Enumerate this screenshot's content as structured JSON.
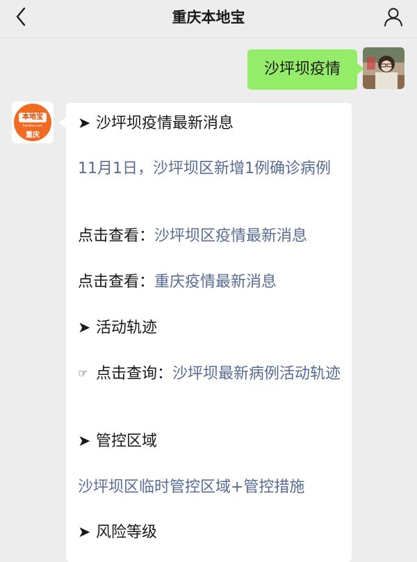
{
  "header": {
    "title": "重庆本地宝",
    "back_icon": "chevron-left-icon",
    "profile_icon": "person-icon"
  },
  "messages": {
    "outgoing": {
      "text": "沙坪坝疫情",
      "bubble_color": "#95ec69"
    },
    "incoming": {
      "avatar": {
        "logo_text": "本地宝",
        "logo_url": "Bendibao.com",
        "logo_city": "重庆",
        "logo_color": "#ef6b23"
      },
      "arrow_symbol": "➤",
      "hand_symbol": "☞",
      "sections": [
        {
          "heading": "沙坪坝疫情最新消息"
        },
        {
          "link": "11月1日，沙坪坝区新增1例确诊病例"
        },
        {
          "prefix": "点击查看：",
          "link": "沙坪坝区疫情最新消息"
        },
        {
          "prefix": "点击查看：",
          "link": "重庆疫情最新消息"
        },
        {
          "heading": "活动轨迹"
        },
        {
          "prefix": "点击查询：",
          "link": "沙坪坝最新病例活动轨迹"
        },
        {
          "heading": "管控区域"
        },
        {
          "link": "沙坪坝区临时管控区域+管控措施"
        },
        {
          "heading": "风险等级"
        }
      ],
      "link_color": "#576b95"
    }
  }
}
